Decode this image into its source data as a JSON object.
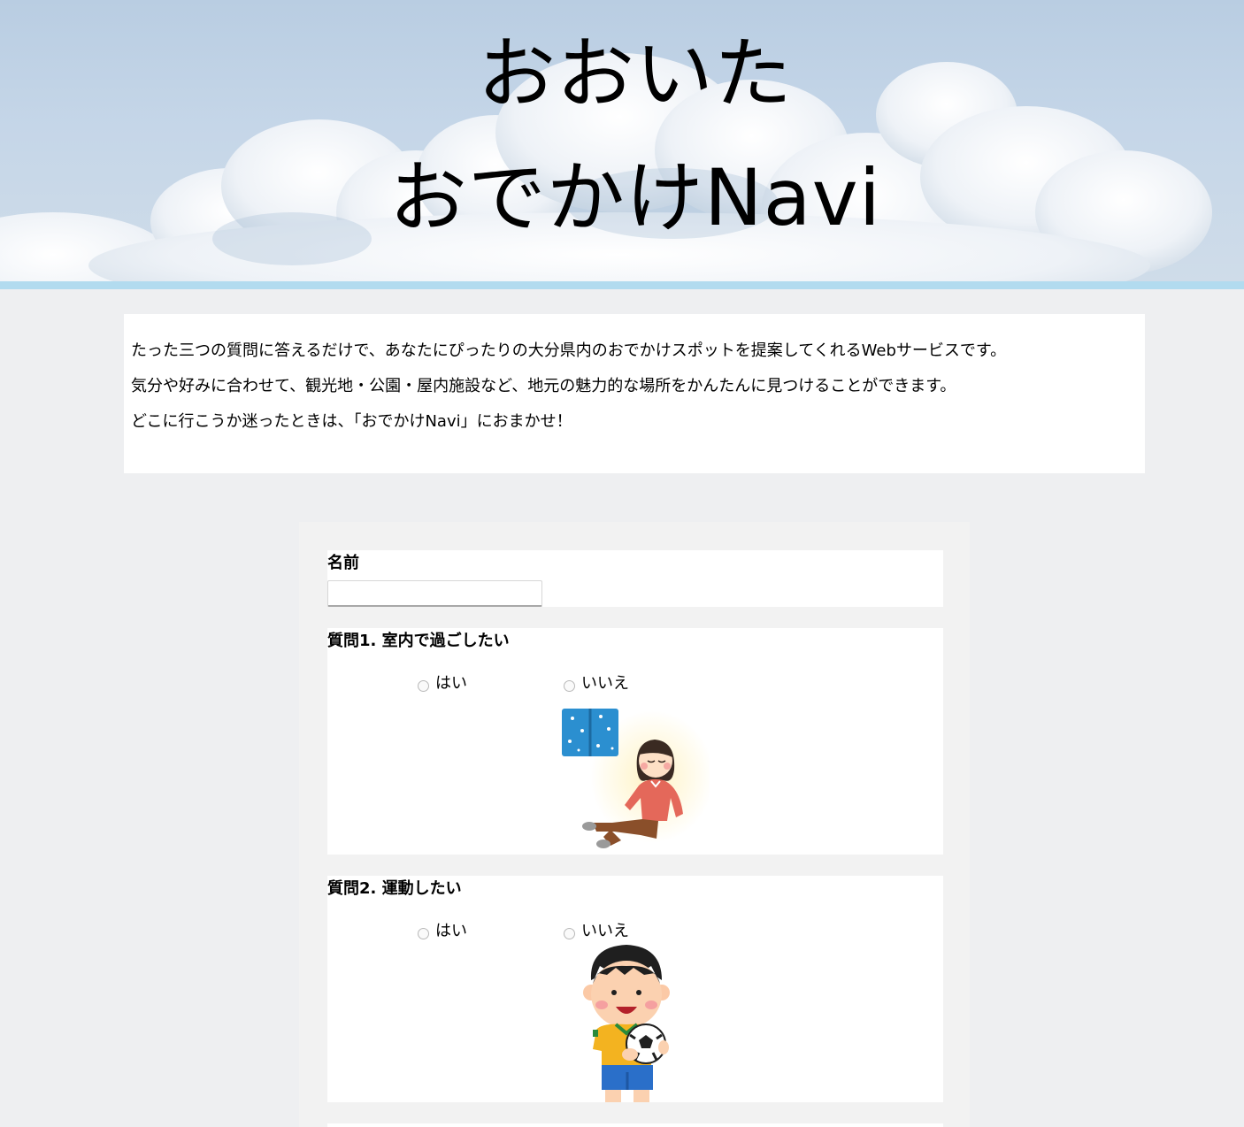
{
  "header": {
    "title_line1": "おおいた",
    "title_line2": "おでかけNavi"
  },
  "intro": {
    "lines": [
      "たった三つの質問に答えるだけで、あなたにぴったりの大分県内のおでかけスポットを提案してくれるWebサービスです。",
      "気分や好みに合わせて、観光地・公園・屋内施設など、地元の魅力的な場所をかんたんに見つけることができます。",
      "どこに行こうか迷ったときは、「おでかけNavi」におまかせ！"
    ]
  },
  "form": {
    "name_label": "名前",
    "name_value": "",
    "questions": [
      {
        "label": "質問1. 室内で過ごしたい",
        "yes": "はい",
        "no": "いいえ",
        "illustration": "relaxing-indoors-girl"
      },
      {
        "label": "質問2. 運動したい",
        "yes": "はい",
        "no": "いいえ",
        "illustration": "boy-with-soccer-ball"
      }
    ]
  },
  "colors": {
    "page_bg": "#eeeff1",
    "accent_bar": "#b2dbef",
    "sky": "#c5d6e8"
  }
}
